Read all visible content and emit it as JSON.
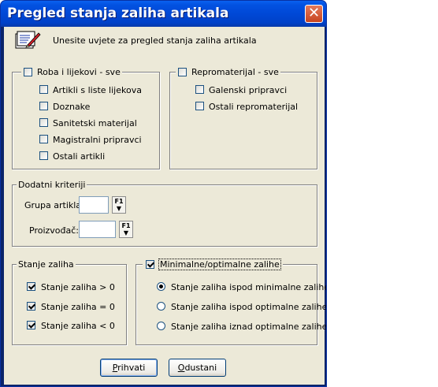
{
  "window": {
    "title": "Pregled stanja zaliha artikala",
    "close_symbol": "✕"
  },
  "intro": {
    "text": "Unesite uvjete za pregled stanja zaliha artikala",
    "icon": "notepad-pencil-icon"
  },
  "roba": {
    "group_label": "Roba i lijekovi - sve",
    "items": [
      "Artikli s liste lijekova",
      "Doznake",
      "Sanitetski materijal",
      "Magistralni pripravci",
      "Ostali artikli"
    ]
  },
  "repro": {
    "group_label": "Repromaterijal - sve",
    "items": [
      "Galenski pripravci",
      "Ostali repromaterijal"
    ]
  },
  "criteria": {
    "legend": "Dodatni kriteriji",
    "grupa_label": "Grupa artikla:",
    "grupa_value": "",
    "proizvodjac_label": "Proizvođač:",
    "proizvodjac_value": "",
    "lookup_button": "F1"
  },
  "stanje": {
    "legend": "Stanje zaliha",
    "items": [
      "Stanje zaliha > 0",
      "Stanje zaliha = 0",
      "Stanje zaliha < 0"
    ],
    "checked": [
      true,
      true,
      true
    ]
  },
  "minopt": {
    "legend": "Minimalne/optimalne zalihe",
    "checked": true,
    "options": [
      "Stanje zaliha ispod minimalne zalihe",
      "Stanje zaliha ispod optimalne zalihe",
      "Stanje zaliha iznad optimalne zalihe"
    ],
    "selected_index": 0
  },
  "buttons": {
    "ok_prefix": "",
    "ok_mnemonic": "P",
    "ok_rest": "rihvati",
    "cancel_prefix": "",
    "cancel_mnemonic": "O",
    "cancel_rest": "dustani"
  }
}
